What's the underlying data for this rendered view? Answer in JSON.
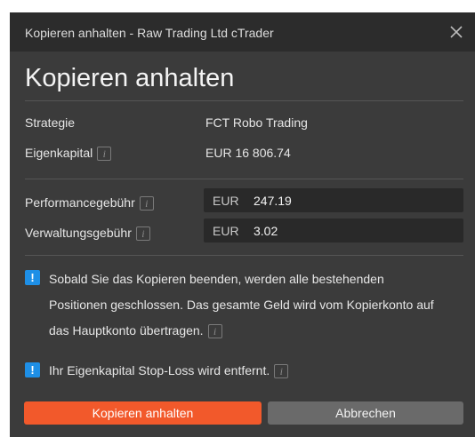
{
  "window": {
    "title": "Kopieren anhalten - Raw Trading Ltd cTrader"
  },
  "dialog": {
    "heading": "Kopieren anhalten",
    "info_glyph": "i",
    "strategy": {
      "label": "Strategie",
      "value": "FCT Robo Trading"
    },
    "equity": {
      "label": "Eigenkapital",
      "value": "EUR 16 806.74"
    },
    "performance_fee": {
      "label": "Performancegebühr",
      "currency": "EUR",
      "amount": "247.19"
    },
    "management_fee": {
      "label": "Verwaltungsgebühr",
      "currency": "EUR",
      "amount": "3.02"
    },
    "warnings": {
      "badge": "!",
      "first_lines": [
        "Sobald Sie das Kopieren beenden, werden alle bestehenden",
        "Positionen geschlossen. Das gesamte Geld wird vom Kopierkonto auf",
        "das Hauptkonto übertragen."
      ],
      "second": "Ihr Eigenkapital Stop-Loss wird entfernt."
    },
    "buttons": {
      "confirm": "Kopieren anhalten",
      "cancel": "Abbrechen"
    }
  },
  "colors": {
    "accent": "#f2592b",
    "info_badge": "#1e8fe6",
    "dialog_bg": "#3b3b3b",
    "titlebar_bg": "#2c2c2c"
  },
  "icons": {
    "close": "close-icon",
    "info": "info-icon",
    "warning": "warning-icon"
  }
}
